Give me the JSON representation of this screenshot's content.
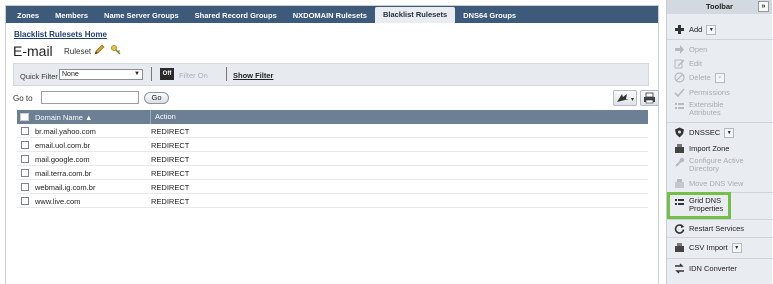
{
  "tabs": [
    "Zones",
    "Members",
    "Name Server Groups",
    "Shared Record Groups",
    "NXDOMAIN Rulesets",
    "Blacklist Rulesets",
    "DNS64 Groups"
  ],
  "active_tab": "Blacklist Rulesets",
  "breadcrumb": "Blacklist Rulesets Home",
  "page_title": "E-mail",
  "ruleset_label": "Ruleset",
  "filter": {
    "quick_filter_label": "Quick Filter",
    "quick_filter_value": "None",
    "off_label": "Off",
    "filter_on_label": "Filter On",
    "show_filter_label": "Show Filter"
  },
  "goto": {
    "label": "Go to",
    "button": "Go"
  },
  "table": {
    "columns": [
      "Domain Name",
      "Action"
    ],
    "rows": [
      {
        "domain": "br.mail.yahoo.com",
        "action": "REDIRECT"
      },
      {
        "domain": "email.uol.com.br",
        "action": "REDIRECT"
      },
      {
        "domain": "mail.google.com",
        "action": "REDIRECT"
      },
      {
        "domain": "mail.terra.com.br",
        "action": "REDIRECT"
      },
      {
        "domain": "webmail.ig.com.br",
        "action": "REDIRECT"
      },
      {
        "domain": "www.live.com",
        "action": "REDIRECT"
      }
    ]
  },
  "toolbar": {
    "title": "Toolbar",
    "expand_icon": "»",
    "items": {
      "add": "Add",
      "open": "Open",
      "edit": "Edit",
      "delete": "Delete",
      "permissions": "Permissions",
      "extensible_1": "Extensible",
      "extensible_2": "Attributes",
      "dnssec": "DNSSEC",
      "import_zone": "Import Zone",
      "configure_1": "Configure Active",
      "configure_2": "Directory",
      "move_dns": "Move DNS View",
      "grid_dns_1": "Grid DNS",
      "grid_dns_2": "Properties",
      "restart": "Restart Services",
      "csv_import": "CSV Import",
      "idn": "IDN Converter"
    }
  },
  "colors": {
    "tab_bar": "#3d5a7a",
    "grid_header": "#6b7f95",
    "highlight": "#74c047",
    "link": "#1d3e70"
  }
}
